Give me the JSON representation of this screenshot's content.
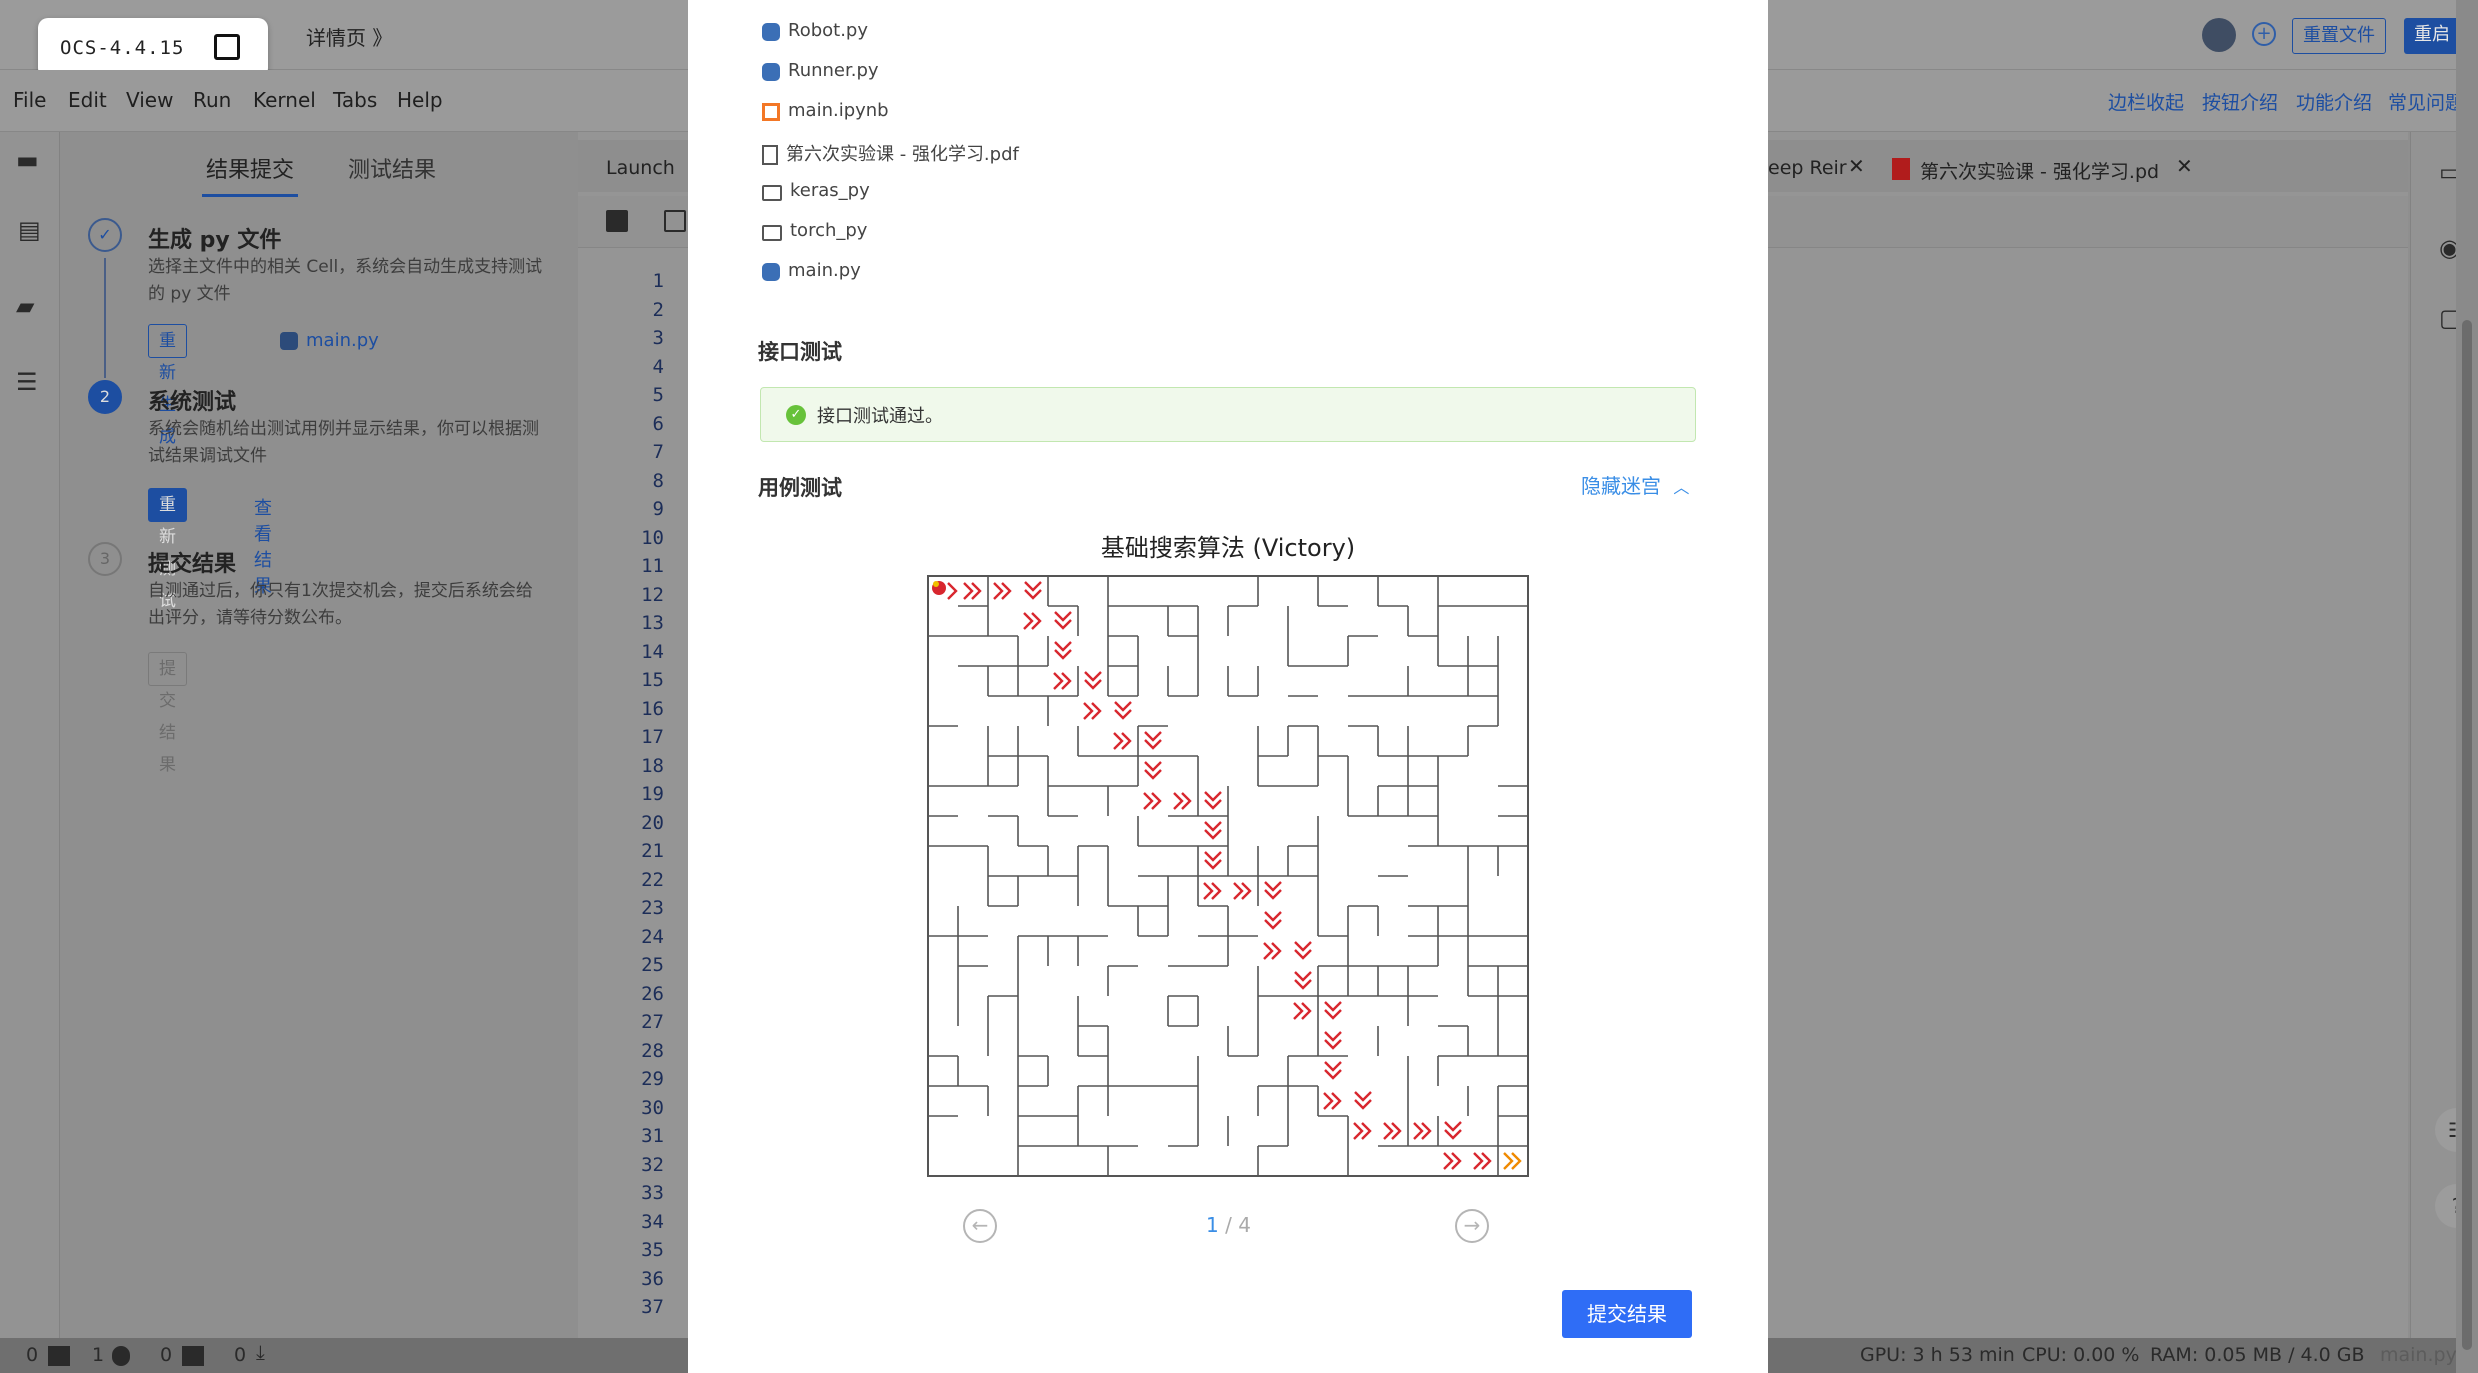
{
  "app": {
    "version": "OCS-4.4.15",
    "detail_link": "详情页 》"
  },
  "menu": [
    "File",
    "Edit",
    "View",
    "Run",
    "Kernel",
    "Tabs",
    "Help"
  ],
  "top_right": {
    "reset_file": "重置文件",
    "restart": "重启",
    "links": [
      "边栏收起",
      "按钮介绍",
      "功能介绍",
      "常见问题"
    ]
  },
  "left_panel": {
    "tabs": [
      "结果提交",
      "测试结果"
    ],
    "steps": [
      {
        "num": "✓",
        "title": "生成 py 文件",
        "desc": "选择主文件中的相关 Cell，系统会自动生成支持测试的 py 文件",
        "button": "重新生成",
        "file": "main.py"
      },
      {
        "num": "2",
        "title": "系统测试",
        "desc": "系统会随机给出测试用例并显示结果，你可以根据测试结果调试文件",
        "button": "重新测试",
        "link": "查看结果"
      },
      {
        "num": "3",
        "title": "提交结果",
        "desc": "自测通过后，你只有1次提交机会，提交后系统会给出评分，请等待分数公布。",
        "button": "提交结果"
      }
    ]
  },
  "editor": {
    "tabs": [
      "Launch",
      "eep Reir",
      "第六次实验课 - 强化学习.pd"
    ],
    "line_numbers": [
      "1",
      "2",
      "3",
      "4",
      "5",
      "6",
      "7",
      "8",
      "9",
      "10",
      "11",
      "12",
      "13",
      "14",
      "15",
      "16",
      "17",
      "18",
      "19",
      "20",
      "21",
      "22",
      "23",
      "24",
      "25",
      "26",
      "27",
      "28",
      "29",
      "30",
      "31",
      "32",
      "33",
      "34",
      "35",
      "36",
      "37"
    ]
  },
  "status_bar": {
    "left": [
      "0",
      "1",
      "0",
      "0"
    ],
    "gpu": "GPU: 3 h 53 min",
    "cpu": "CPU: 0.00 %",
    "ram": "RAM: 0.05 MB / 4.0 GB",
    "file": "main.py"
  },
  "modal": {
    "files": [
      {
        "name": "Robot.py",
        "icon": "python-icon"
      },
      {
        "name": "Runner.py",
        "icon": "python-icon"
      },
      {
        "name": "main.ipynb",
        "icon": "notebook-icon"
      },
      {
        "name": "第六次实验课 - 强化学习.pdf",
        "icon": "file-icon"
      },
      {
        "name": "keras_py",
        "icon": "folder-icon"
      },
      {
        "name": "torch_py",
        "icon": "folder-icon"
      },
      {
        "name": "main.py",
        "icon": "python-icon"
      }
    ],
    "interface_title": "接口测试",
    "interface_pass": "接口测试通过。",
    "case_title": "用例测试",
    "hide_maze": "隐藏迷宫",
    "maze_title": "基础搜索算法  (Victory)",
    "page_current": "1",
    "page_total": " / 4",
    "submit": "提交结果",
    "colors": {
      "accent": "#3a8ee6",
      "submit": "#2f6df6",
      "path": "#d8262e",
      "pass_bg": "#f0f9eb"
    }
  }
}
